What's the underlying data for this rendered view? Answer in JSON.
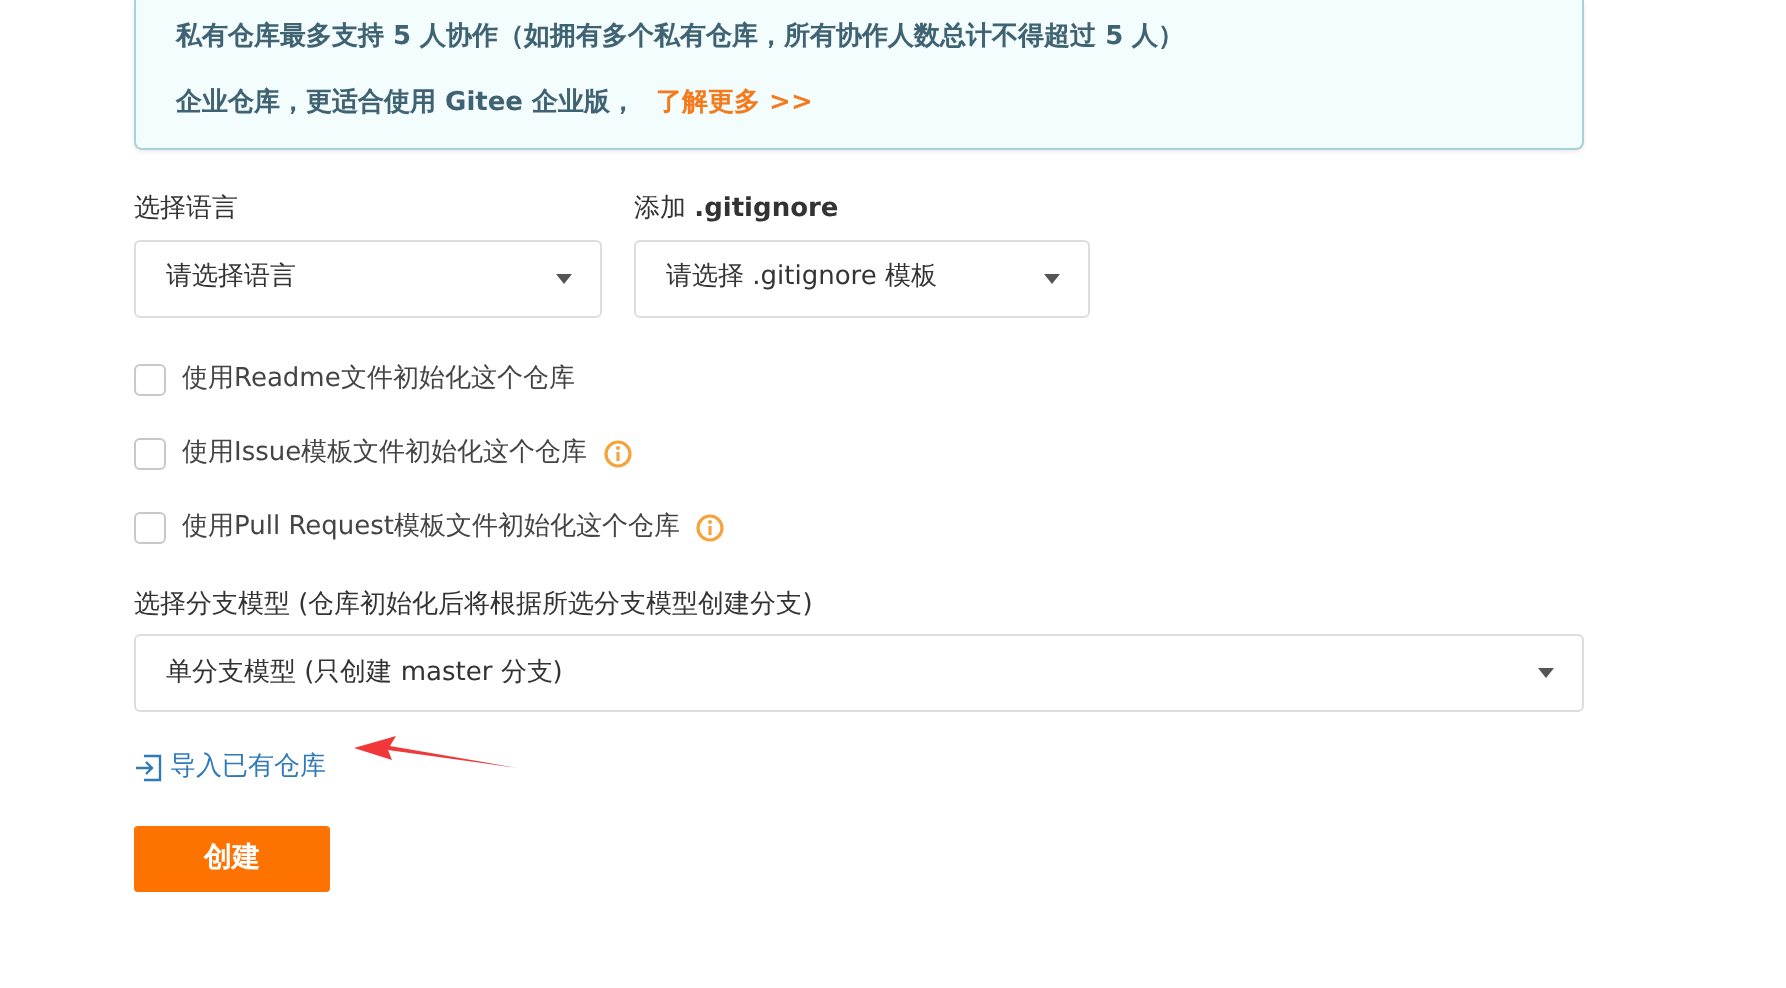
{
  "notice": {
    "lines": [
      {
        "text": "私有仓库最多支持 5 人协作（如拥有多个私有仓库，所有协作人数总计不得超过 5 人）"
      },
      {
        "text": "企业仓库，更适合使用 Gitee 企业版，",
        "link": "了解更多 >>"
      }
    ]
  },
  "selects": [
    {
      "label": "选择语言",
      "value": "请选择语言"
    },
    {
      "label": "添加 **.gitignore**",
      "value": "请选择 .gitignore 模板"
    }
  ],
  "checkboxes": [
    {
      "label": "使用Readme文件初始化这个仓库",
      "checked": false,
      "info": false
    },
    {
      "label": "使用Issue模板文件初始化这个仓库",
      "checked": false,
      "info": true
    },
    {
      "label": "使用Pull Request模板文件初始化这个仓库",
      "checked": false,
      "info": true
    }
  ],
  "branch_model": {
    "label": "选择分支模型 (仓库初始化后将根据所选分支模型创建分支)",
    "value": "单分支模型 (只创建 master 分支)"
  },
  "import_link": "导入已有仓库",
  "submit": "创建"
}
